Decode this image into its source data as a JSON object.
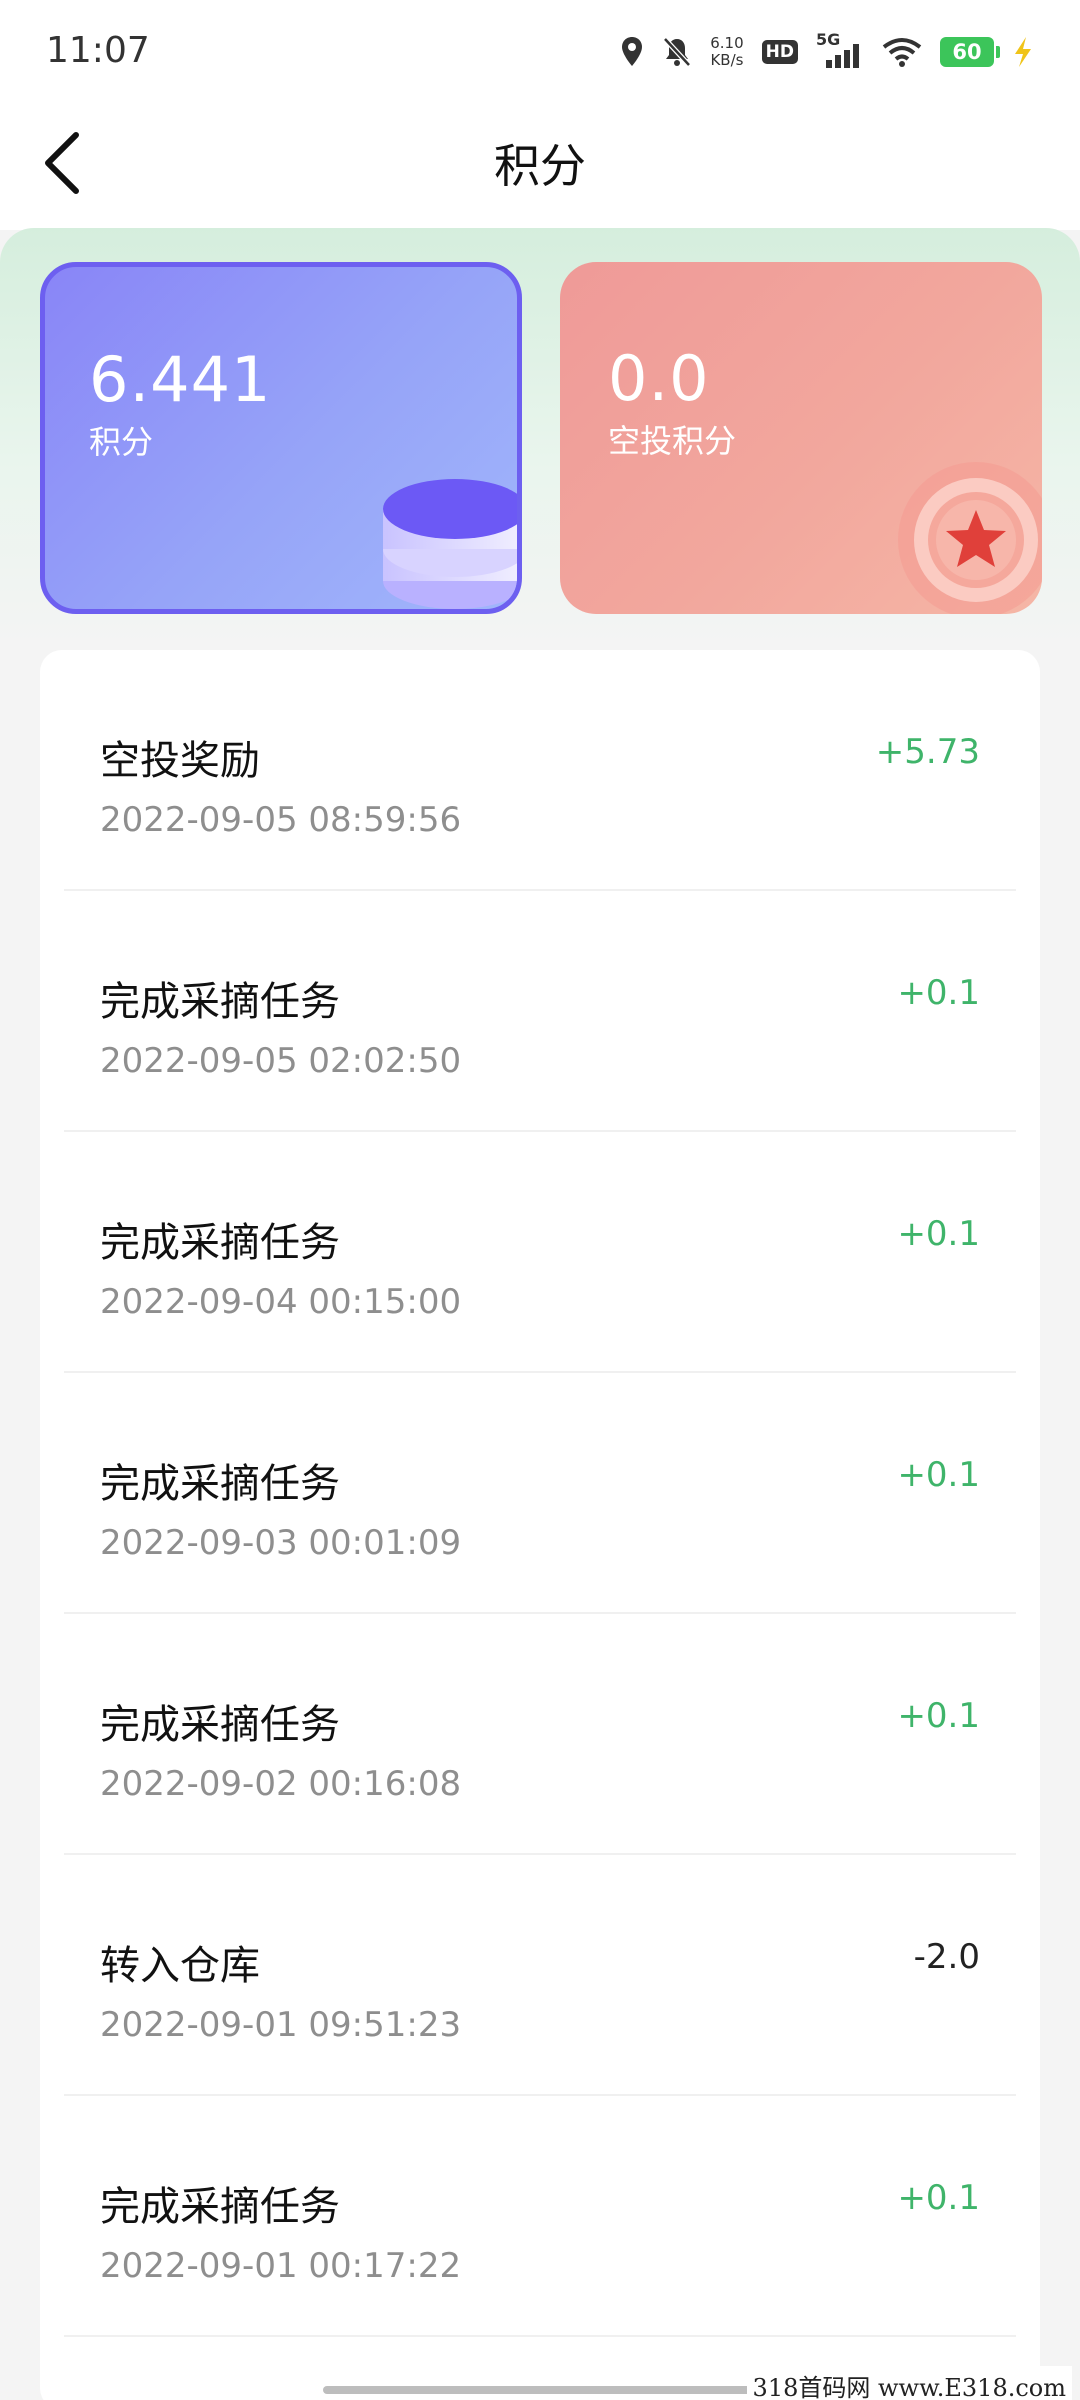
{
  "status_bar": {
    "time": "11:07",
    "net_speed_value": "6.10",
    "net_speed_unit": "KB/s",
    "hd_badge": "HD",
    "signal_label": "5G",
    "battery_level": "60",
    "icons": [
      "location-icon",
      "mute-icon",
      "signal-icon",
      "wifi-icon",
      "battery-icon",
      "charging-icon"
    ]
  },
  "header": {
    "title": "积分",
    "back_icon": "chevron-left-icon"
  },
  "cards": {
    "points": {
      "value": "6.441",
      "label": "积分",
      "icon": "coin-stack-icon",
      "color": "#8985f7"
    },
    "airdrop": {
      "value": "0.0",
      "label": "空投积分",
      "icon": "star-medal-icon",
      "color": "#ef9a98"
    }
  },
  "colors": {
    "positive": "#3fb46a",
    "negative": "#222222",
    "band": "#d5eedd"
  },
  "records": [
    {
      "title": "空投奖励",
      "time": "2022-09-05 08:59:56",
      "amount": "+5.73",
      "sign": "pos"
    },
    {
      "title": "完成采摘任务",
      "time": "2022-09-05 02:02:50",
      "amount": "+0.1",
      "sign": "pos"
    },
    {
      "title": "完成采摘任务",
      "time": "2022-09-04 00:15:00",
      "amount": "+0.1",
      "sign": "pos"
    },
    {
      "title": "完成采摘任务",
      "time": "2022-09-03 00:01:09",
      "amount": "+0.1",
      "sign": "pos"
    },
    {
      "title": "完成采摘任务",
      "time": "2022-09-02 00:16:08",
      "amount": "+0.1",
      "sign": "pos"
    },
    {
      "title": "转入仓库",
      "time": "2022-09-01 09:51:23",
      "amount": "-2.0",
      "sign": "neg"
    },
    {
      "title": "完成采摘任务",
      "time": "2022-09-01 00:17:22",
      "amount": "+0.1",
      "sign": "pos"
    }
  ],
  "watermark": "318首码网  www.E318.com"
}
